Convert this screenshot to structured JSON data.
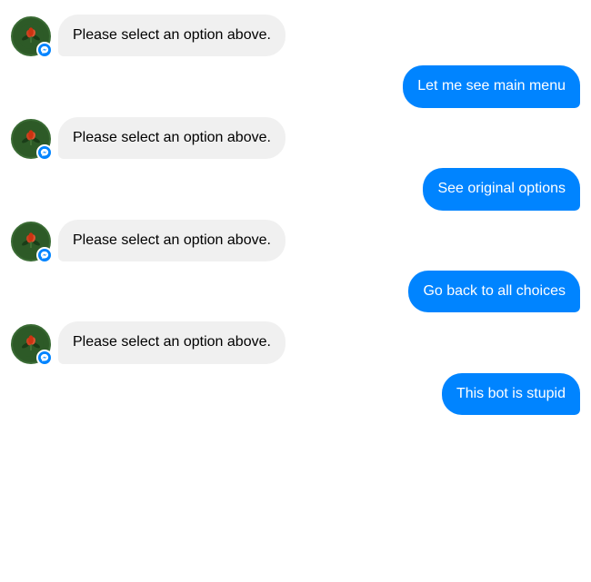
{
  "messages": [
    {
      "id": "msg1",
      "type": "bot",
      "text": "Please select an option above."
    },
    {
      "id": "msg2",
      "type": "user",
      "text": "Let me see main menu"
    },
    {
      "id": "msg3",
      "type": "bot",
      "text": "Please select an option above."
    },
    {
      "id": "msg4",
      "type": "user",
      "text": "See original options"
    },
    {
      "id": "msg5",
      "type": "bot",
      "text": "Please select an option above."
    },
    {
      "id": "msg6",
      "type": "user",
      "text": "Go back to all choices"
    },
    {
      "id": "msg7",
      "type": "bot",
      "text": "Please select an option above."
    },
    {
      "id": "msg8",
      "type": "user",
      "text": "This bot is stupid"
    }
  ],
  "colors": {
    "user_bubble": "#0084ff",
    "bot_bubble": "#f0f0f0",
    "messenger_blue": "#0084ff",
    "avatar_bg": "#2d5a27"
  }
}
